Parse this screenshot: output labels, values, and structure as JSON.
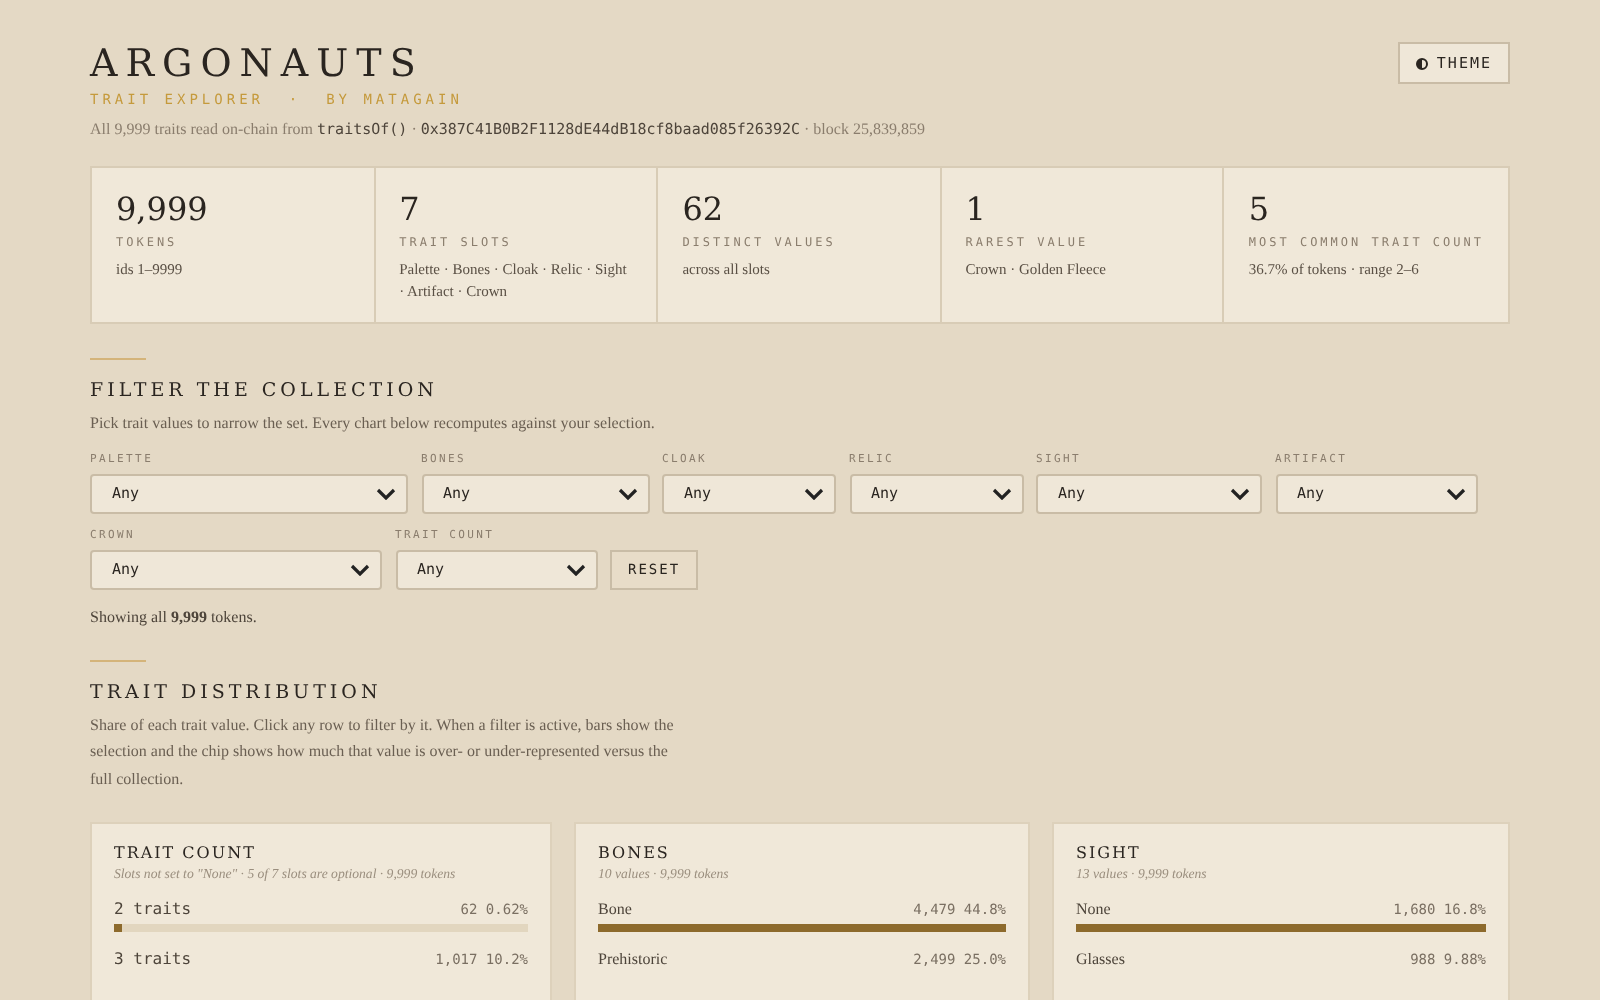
{
  "header": {
    "title": "ARGONAUTS",
    "subtitle": "TRAIT EXPLORER  ·  BY MATAGAIN",
    "meta_prefix": "All 9,999 traits read on-chain from",
    "meta_fn": "traitsOf()",
    "meta_separator": "·",
    "meta_address": "0x387C41B0B2F1128dE44dB18cf8baad085f26392C",
    "meta_suffix": "· block 25,839,859",
    "theme_button": "THEME"
  },
  "stats": [
    {
      "value": "9,999",
      "label": "TOKENS",
      "detail": "ids 1–9999"
    },
    {
      "value": "7",
      "label": "TRAIT SLOTS",
      "detail": "Palette · Bones · Cloak · Relic · Sight · Artifact · Crown"
    },
    {
      "value": "62",
      "label": "DISTINCT VALUES",
      "detail": "across all slots"
    },
    {
      "value": "1",
      "label": "RAREST VALUE",
      "detail": "Crown · Golden Fleece"
    },
    {
      "value": "5",
      "label": "MOST COMMON TRAIT COUNT",
      "detail": "36.7% of tokens · range 2–6"
    }
  ],
  "filter": {
    "heading": "FILTER THE COLLECTION",
    "description": "Pick trait values to narrow the set. Every chart below recomputes against your selection.",
    "selects": [
      {
        "label": "PALETTE",
        "value": "Any"
      },
      {
        "label": "BONES",
        "value": "Any"
      },
      {
        "label": "CLOAK",
        "value": "Any"
      },
      {
        "label": "RELIC",
        "value": "Any"
      },
      {
        "label": "SIGHT",
        "value": "Any"
      },
      {
        "label": "ARTIFACT",
        "value": "Any"
      },
      {
        "label": "CROWN",
        "value": "Any"
      },
      {
        "label": "TRAIT COUNT",
        "value": "Any"
      }
    ],
    "reset_button": "RESET",
    "summary": "Showing all **9,999** tokens."
  },
  "distribution": {
    "heading": "TRAIT DISTRIBUTION",
    "description": "Share of each trait value. Click any row to filter by it. When a filter is active, bars show the selection and the chip shows how much that value is over- or under-represented versus the full collection.",
    "cards": [
      {
        "title": "TRAIT COUNT",
        "subtitle": "Slots not set to \"None\" · 5 of 7 slots are optional · 9,999 tokens",
        "kind": "mono",
        "rows": [
          {
            "label": "2 traits",
            "count": "62",
            "share": "0.62%",
            "level": 0.017
          },
          {
            "label": "3 traits",
            "count": "1,017",
            "share": "10.2%"
          }
        ]
      },
      {
        "title": "BONES",
        "subtitle": "10 values · 9,999 tokens",
        "kind": "serif",
        "rows": [
          {
            "label": "Bone",
            "count": "4,479",
            "share": "44.8%",
            "level": 1
          },
          {
            "label": "Prehistoric",
            "count": "2,499",
            "share": "25.0%"
          }
        ]
      },
      {
        "title": "SIGHT",
        "subtitle": "13 values · 9,999 tokens",
        "kind": "serif",
        "rows": [
          {
            "label": "None",
            "count": "1,680",
            "share": "16.8%",
            "level": 1
          },
          {
            "label": "Glasses",
            "count": "988",
            "share": "9.88%"
          }
        ]
      }
    ]
  }
}
